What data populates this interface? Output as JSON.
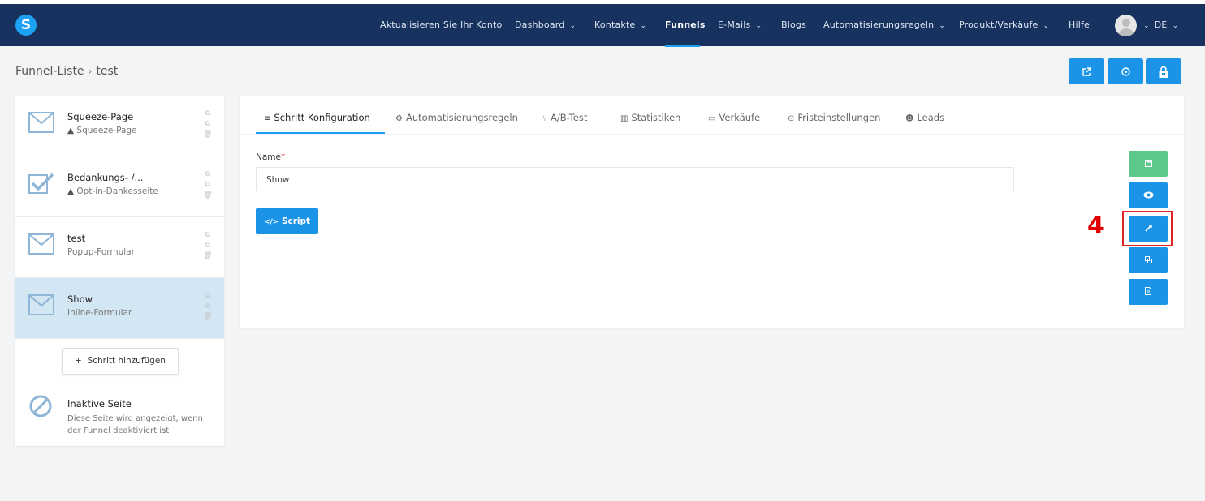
{
  "brand": {
    "logo_letter": "S",
    "accent_color": "#1da1f2",
    "navbar_color": "#17325f"
  },
  "nav": {
    "items": [
      {
        "label": "Aktualisieren Sie Ihr Konto"
      },
      {
        "label": "Dashboard",
        "chevron": "⌄"
      },
      {
        "label": "Kontakte",
        "chevron": "⌄"
      },
      {
        "label": "Funnels",
        "active": true
      },
      {
        "label": "E-Mails",
        "chevron": "⌄"
      },
      {
        "label": "Blogs"
      },
      {
        "label": "Automatisierungsregeln",
        "chevron": "⌄"
      },
      {
        "label": "Produkt/Verkäufe",
        "chevron": "⌄"
      },
      {
        "label": "Hilfe"
      }
    ],
    "language": "DE",
    "language_chevron": "⌄"
  },
  "breadcrumb": {
    "root": "Funnel-Liste",
    "separator": "›",
    "current": "test"
  },
  "header_buttons": [
    {
      "icon": "external-link-icon"
    },
    {
      "icon": "settings-icon"
    },
    {
      "icon": "lock-icon"
    }
  ],
  "steps": [
    {
      "title": "Squeeze-Page",
      "subtitle": "Squeeze-Page",
      "warning": "▲",
      "icon": "envelope-icon"
    },
    {
      "title": "Bedankungs- /...",
      "subtitle": "Opt-in-Dankesseite",
      "warning": "▲",
      "icon": "checkbox-icon"
    },
    {
      "title": "test",
      "subtitle": "Popup-Formular",
      "icon": "envelope-icon"
    },
    {
      "title": "Show",
      "subtitle": "Inline-Formular",
      "icon": "envelope-icon",
      "selected": true
    }
  ],
  "add_step": {
    "plus": "+",
    "label": "Schritt hinzufügen"
  },
  "inactive_page": {
    "title": "Inaktive Seite",
    "description": "Diese Seite wird angezeigt, wenn der Funnel deaktiviert ist"
  },
  "tabs": [
    {
      "icon": "≡",
      "label": "Schritt Konfiguration",
      "active": true
    },
    {
      "icon": "⚙",
      "label": "Automatisierungsregeln"
    },
    {
      "icon": "⑂",
      "label": "A/B-Test"
    },
    {
      "icon": "▥",
      "label": "Statistiken"
    },
    {
      "icon": "▭",
      "label": "Verkäufe"
    },
    {
      "icon": "⊙",
      "label": "Fristeinstellungen"
    },
    {
      "icon": "☻",
      "label": "Leads"
    }
  ],
  "form": {
    "name_label": "Name",
    "required_mark": "*",
    "name_value": "Show"
  },
  "script_button": {
    "icon": "</>",
    "label": "Script"
  },
  "side_buttons": [
    {
      "icon": "save-icon",
      "color": "#5cc98a"
    },
    {
      "icon": "eye-icon",
      "color": "#1b93e6"
    },
    {
      "icon": "edit-icon",
      "color": "#1b93e6"
    },
    {
      "icon": "copy-icon",
      "color": "#1b93e6"
    },
    {
      "icon": "document-icon",
      "color": "#1b93e6"
    }
  ],
  "annotation": {
    "number": "4",
    "color": "#e00000"
  }
}
